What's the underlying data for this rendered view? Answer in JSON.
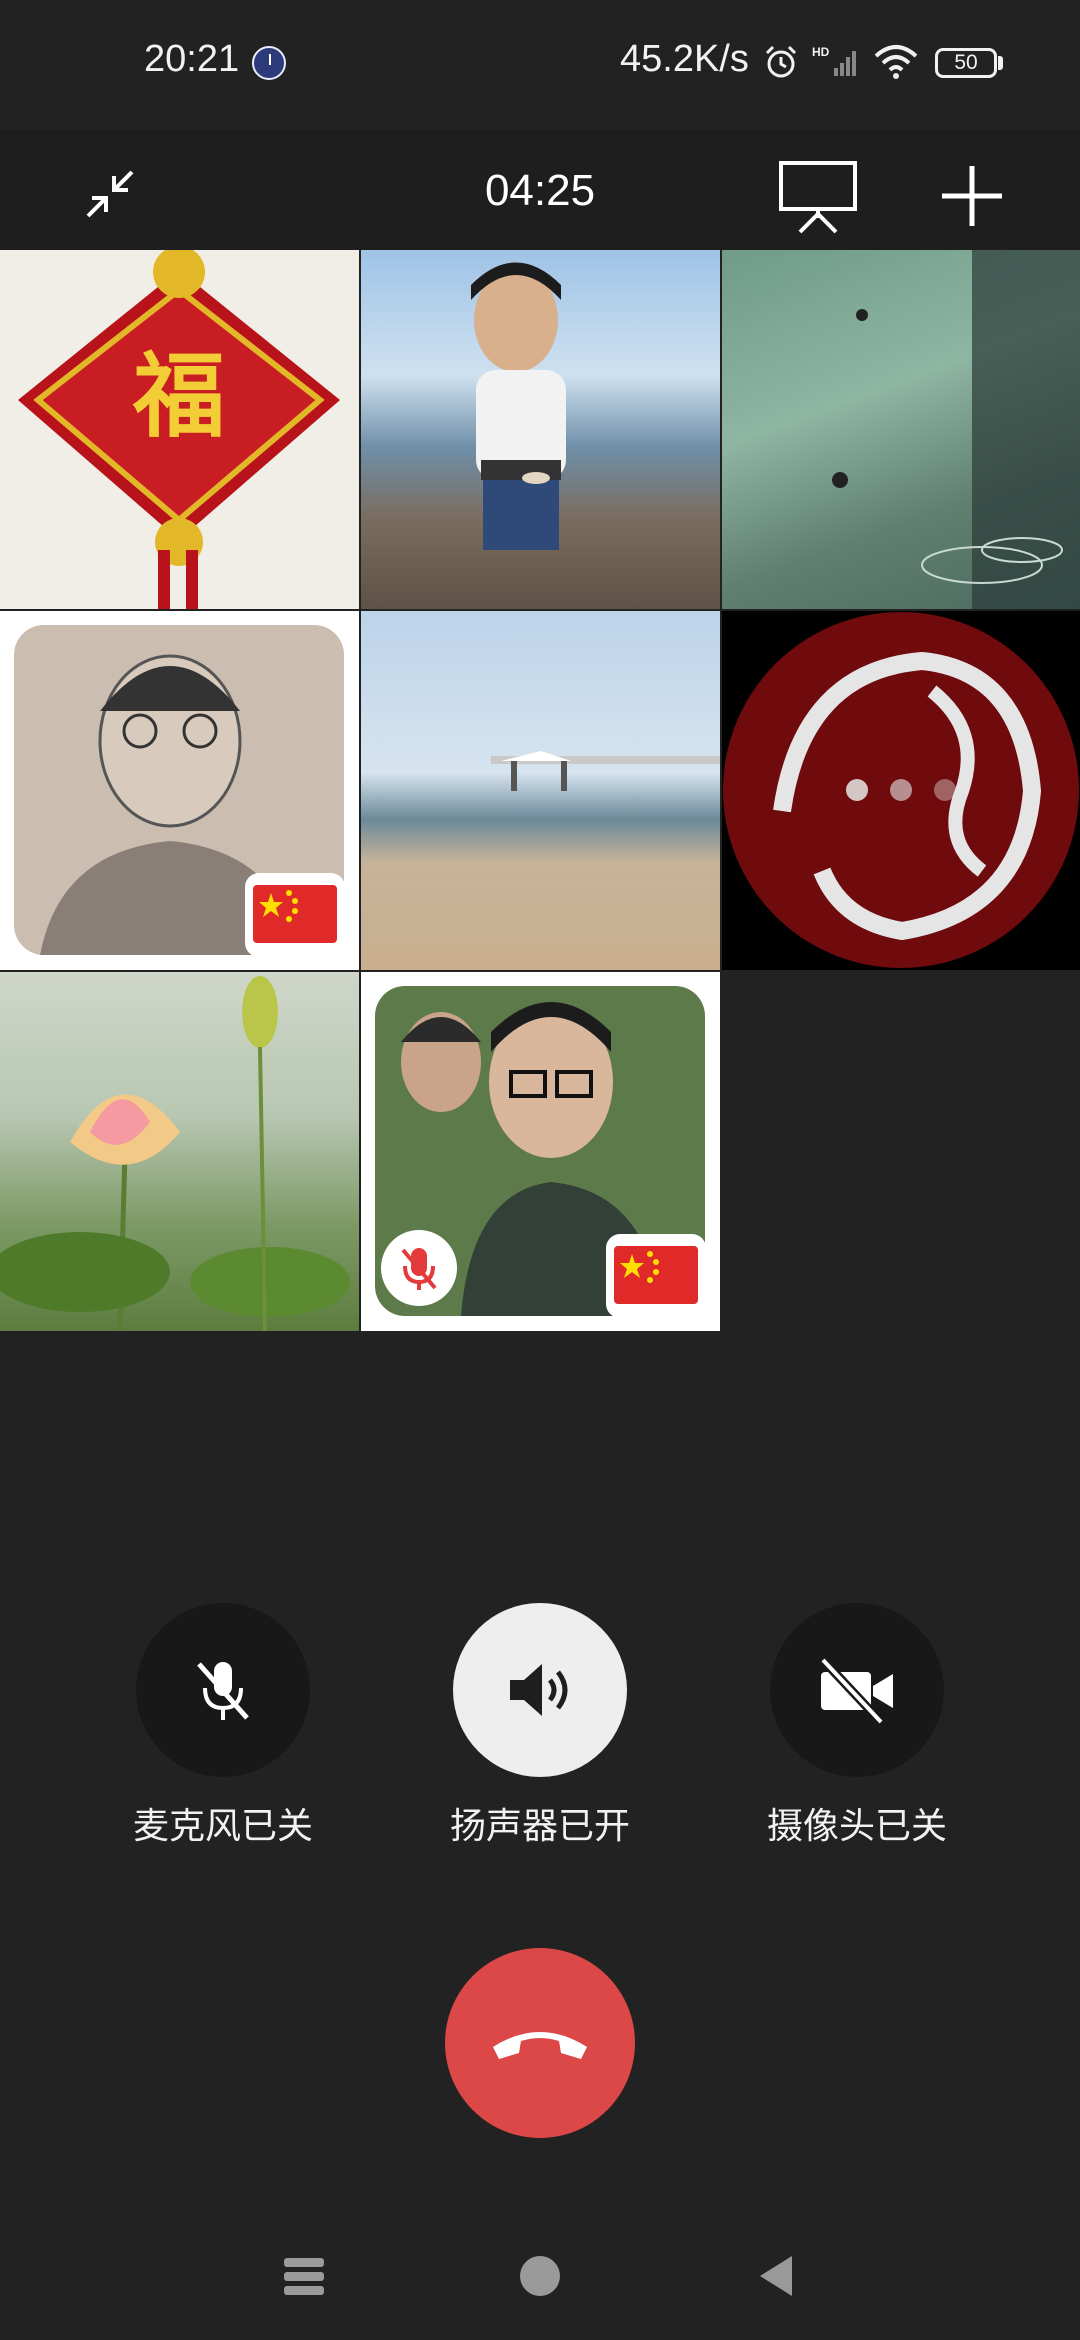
{
  "status_bar": {
    "time": "20:21",
    "network_speed": "45.2K/s",
    "battery": "50",
    "icons": [
      "clock-app-icon",
      "alarm-icon",
      "hd-signal-icon",
      "wifi-icon",
      "battery-icon"
    ]
  },
  "call": {
    "timer": "04:25",
    "header_icons": [
      "collapse-icon",
      "screen-share-icon",
      "add-participant-icon"
    ]
  },
  "participants": [
    {
      "tile": 1,
      "has_flag": false,
      "muted": false
    },
    {
      "tile": 2,
      "has_flag": false,
      "muted": false
    },
    {
      "tile": 3,
      "has_flag": false,
      "muted": false
    },
    {
      "tile": 4,
      "has_flag": true,
      "muted": false
    },
    {
      "tile": 5,
      "has_flag": false,
      "muted": false
    },
    {
      "tile": 6,
      "has_flag": false,
      "muted": false,
      "connecting": true
    },
    {
      "tile": 7,
      "has_flag": false,
      "muted": false
    },
    {
      "tile": 8,
      "has_flag": true,
      "muted": true
    }
  ],
  "controls": {
    "mic_label": "麦克风已关",
    "speaker_label": "扬声器已开",
    "camera_label": "摄像头已关"
  },
  "colors": {
    "background": "#222222",
    "hangup": "#dc4848",
    "speaker_active": "#eeeeee",
    "control_inactive": "#181818"
  }
}
